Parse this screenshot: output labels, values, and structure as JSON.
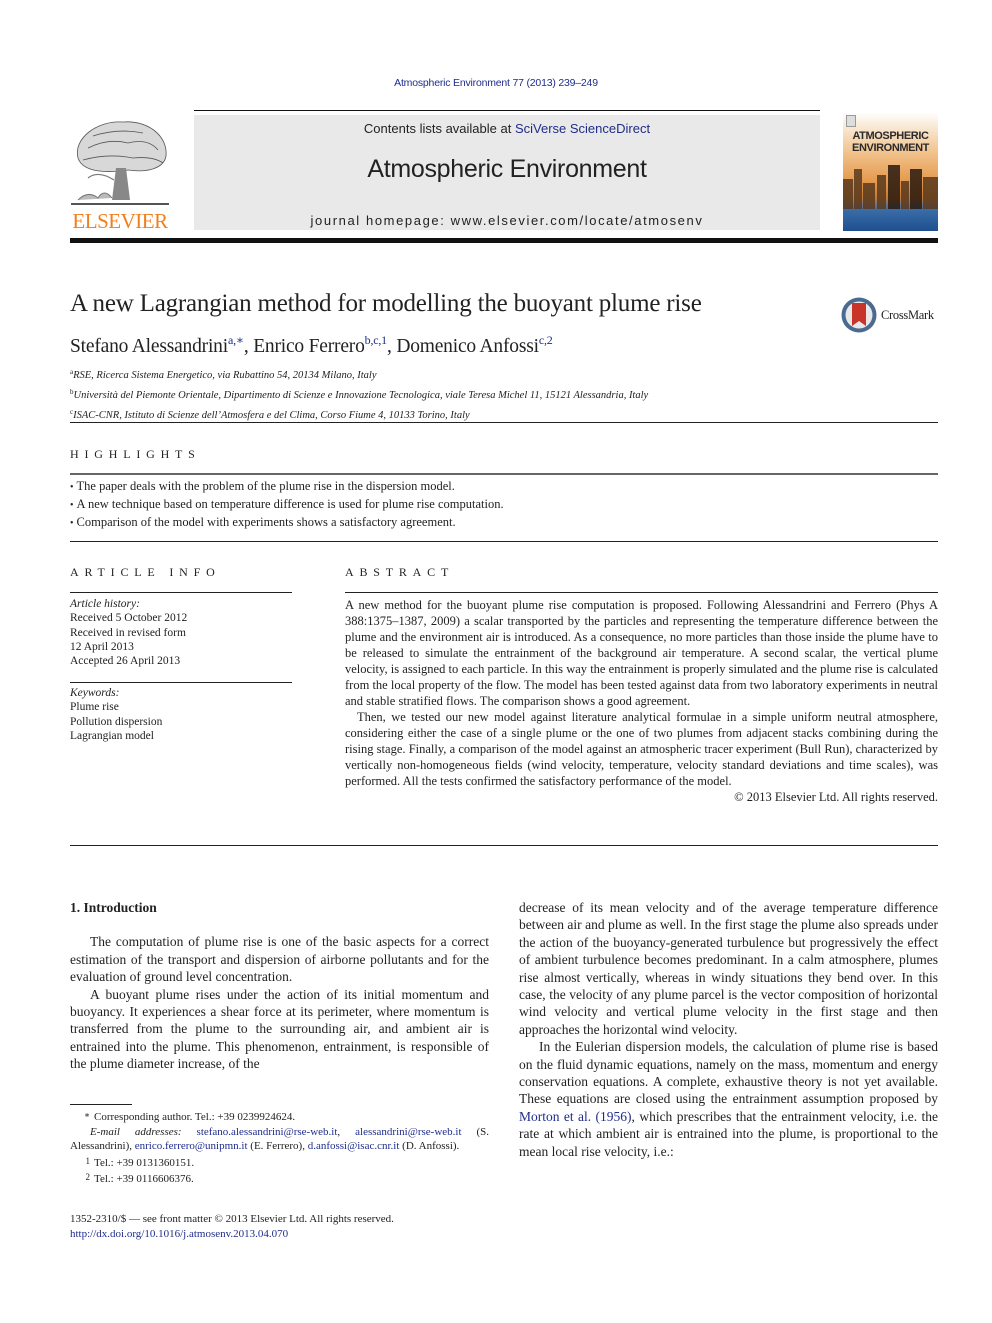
{
  "header": {
    "citation": "Atmospheric Environment 77 (2013) 239–249",
    "contents_prefix": "Contents lists available at ",
    "contents_link": "SciVerse ScienceDirect",
    "journal_title": "Atmospheric Environment",
    "homepage": "journal homepage: www.elsevier.com/locate/atmosenv",
    "publisher_logo_text": "ELSEVIER",
    "cover_title_line1": "ATMOSPHERIC",
    "cover_title_line2": "ENVIRONMENT"
  },
  "colors": {
    "link": "#1f2d8a",
    "elsevier_orange": "#f07f1d",
    "banner_bg": "#e9e9e9"
  },
  "article": {
    "title": "A new Lagrangian method for modelling the buoyant plume rise",
    "crossmark_label": "CrossMark",
    "authors": [
      {
        "name": "Stefano Alessandrini",
        "sup": "a,∗",
        "sep": ", "
      },
      {
        "name": "Enrico Ferrero",
        "sup": "b,c,1",
        "sep": ", "
      },
      {
        "name": "Domenico Anfossi",
        "sup": "c,2",
        "sep": ""
      }
    ],
    "affiliations": [
      {
        "mark": "a",
        "text": "RSE, Ricerca Sistema Energetico, via Rubattino 54, 20134 Milano, Italy"
      },
      {
        "mark": "b",
        "text": "Università del Piemonte Orientale, Dipartimento di Scienze e Innovazione Tecnologica, viale Teresa Michel 11, 15121 Alessandria, Italy"
      },
      {
        "mark": "c",
        "text": "ISAC-CNR, Istituto di Scienze dell’Atmosfera e del Clima, Corso Fiume 4, 10133 Torino, Italy"
      }
    ]
  },
  "highlights": {
    "heading": "HIGHLIGHTS",
    "items": [
      "The paper deals with the problem of the plume rise in the dispersion model.",
      "A new technique based on temperature difference is used for plume rise computation.",
      "Comparison of the model with experiments shows a satisfactory agreement."
    ]
  },
  "article_info": {
    "heading": "ARTICLE INFO",
    "history_label": "Article history:",
    "history": [
      "Received 5 October 2012",
      "Received in revised form",
      "12 April 2013",
      "Accepted 26 April 2013"
    ],
    "keywords_label": "Keywords:",
    "keywords": [
      "Plume rise",
      "Pollution dispersion",
      "Lagrangian model"
    ]
  },
  "abstract": {
    "heading": "ABSTRACT",
    "paragraphs": [
      "A new method for the buoyant plume rise computation is proposed. Following Alessandrini and Ferrero (Phys A 388:1375–1387, 2009) a scalar transported by the particles and representing the temperature difference between the plume and the environment air is introduced. As a consequence, no more particles than those inside the plume have to be released to simulate the entrainment of the background air temperature. A second scalar, the vertical plume velocity, is assigned to each particle. In this way the entrainment is properly simulated and the plume rise is calculated from the local property of the flow. The model has been tested against data from two laboratory experiments in neutral and stable stratified flows. The comparison shows a good agreement.",
      "Then, we tested our new model against literature analytical formulae in a simple uniform neutral atmosphere, considering either the case of a single plume or the one of two plumes from adjacent stacks combining during the rising stage. Finally, a comparison of the model against an atmospheric tracer experiment (Bull Run), characterized by vertically non-homogeneous fields (wind velocity, temperature, velocity standard deviations and time scales), was performed. All the tests confirmed the satisfactory performance of the model."
    ],
    "copyright": "© 2013 Elsevier Ltd. All rights reserved."
  },
  "body": {
    "section_heading": "1.  Introduction",
    "left_paragraphs": [
      "The computation of plume rise is one of the basic aspects for a correct estimation of the transport and dispersion of airborne pollutants and for the evaluation of ground level concentration.",
      "A buoyant plume rises under the action of its initial momentum and buoyancy. It experiences a shear force at its perimeter, where momentum is transferred from the plume to the surrounding air, and ambient air is entrained into the plume. This phenomenon, entrainment, is responsible of the plume diameter increase, of the"
    ],
    "right_paragraph_1": "decrease of its mean velocity and of the average temperature difference between air and plume as well. In the first stage the plume also spreads under the action of the buoyancy-generated turbulence but progressively the effect of ambient turbulence becomes predominant. In a calm atmosphere, plumes rise almost vertically, whereas in windy situations they bend over. In this case, the velocity of any plume parcel is the vector composition of horizontal wind velocity and vertical plume velocity in the first stage and then approaches the horizontal wind velocity.",
    "right_paragraph_2_before": "In the Eulerian dispersion models, the calculation of plume rise is based on the fluid dynamic equations, namely on the mass, momentum and energy conservation equations. A complete, exhaustive theory is not yet available. These equations are closed using the entrainment assumption proposed by ",
    "right_paragraph_2_link": "Morton et al. (1956)",
    "right_paragraph_2_after": ", which prescribes that the entrainment velocity, i.e. the rate at which ambient air is entrained into the plume, is proportional to the mean local rise velocity, i.e.:"
  },
  "footnotes": {
    "corresponding_mark": "∗",
    "corresponding": "Corresponding author. Tel.: +39 0239924624.",
    "email_label": "E-mail addresses:",
    "emails": [
      "stefano.alessandrini@rse-web.it",
      "alessandrini@rse-web.it",
      "enrico.ferrero@unipmn.it",
      "d.anfossi@isac.cnr.it"
    ],
    "email_owner_1": "(S. Alessandrini),",
    "email_owner_2": "(E. Ferrero),",
    "email_owner_3": "(D. Anfossi).",
    "note1_mark": "1",
    "note1": "Tel.: +39 0131360151.",
    "note2_mark": "2",
    "note2": "Tel.: +39 0116606376."
  },
  "front_matter": {
    "issn_line": "1352-2310/$ — see front matter © 2013 Elsevier Ltd. All rights reserved.",
    "doi": "http://dx.doi.org/10.1016/j.atmosenv.2013.04.070"
  }
}
